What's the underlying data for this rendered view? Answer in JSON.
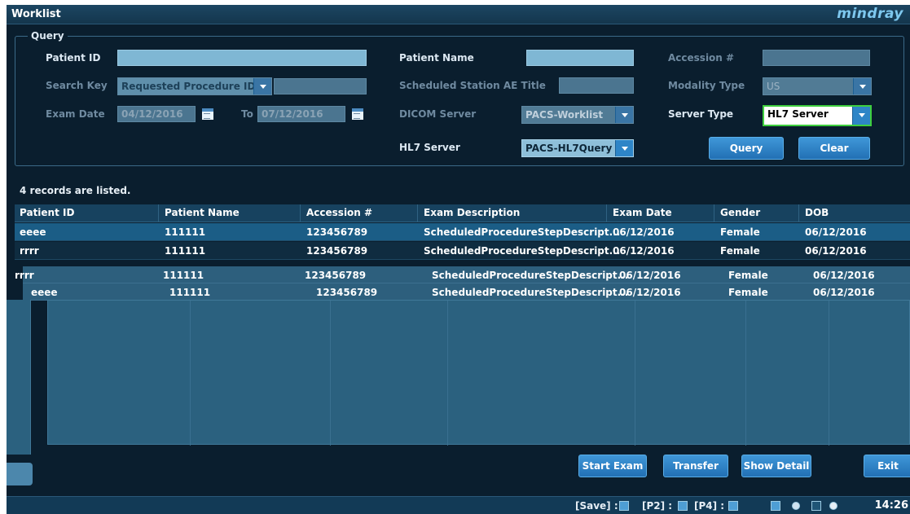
{
  "window": {
    "title": "Worklist",
    "brand": "mindray"
  },
  "query": {
    "legend": "Query",
    "patient_id": {
      "label": "Patient ID",
      "value": ""
    },
    "patient_name": {
      "label": "Patient Name",
      "value": ""
    },
    "accession": {
      "label": "Accession #",
      "value": ""
    },
    "search_key": {
      "label": "Search Key",
      "selected": "Requested Procedure ID",
      "value": ""
    },
    "station_ae": {
      "label": "Scheduled Station AE Title",
      "value": ""
    },
    "modality": {
      "label": "Modality Type",
      "selected": "US"
    },
    "exam_date": {
      "label": "Exam Date",
      "from": "04/12/2016",
      "to_label": "To",
      "to": "07/12/2016"
    },
    "dicom_server": {
      "label": "DICOM Server",
      "selected": "PACS-Worklist"
    },
    "server_type": {
      "label": "Server Type",
      "selected": "HL7 Server"
    },
    "hl7_server": {
      "label": "HL7 Server",
      "selected": "PACS-HL7Query"
    },
    "query_button": "Query",
    "clear_button": "Clear"
  },
  "records_text": "4 records are listed.",
  "table": {
    "columns": [
      "Patient ID",
      "Patient Name",
      "Accession #",
      "Exam Description",
      "Exam Date",
      "Gender",
      "DOB"
    ],
    "rows": [
      [
        "eeee",
        "111111",
        "123456789",
        "ScheduledProcedureStepDescript...",
        "06/12/2016",
        "Female",
        "06/12/2016"
      ],
      [
        "rrrr",
        "111111",
        "123456789",
        "ScheduledProcedureStepDescript...",
        "06/12/2016",
        "Female",
        "06/12/2016"
      ],
      [
        "rrrr",
        "111111",
        "123456789",
        "ScheduledProcedureStepDescript...",
        "06/12/2016",
        "Female",
        "06/12/2016"
      ],
      [
        "eeee",
        "111111",
        "123456789",
        "ScheduledProcedureStepDescript...",
        "06/12/2016",
        "Female",
        "06/12/2016"
      ]
    ],
    "selected_row": 0
  },
  "actions": {
    "start_exam": "Start Exam",
    "transfer": "Transfer",
    "show_detail": "Show Detail",
    "exit": "Exit"
  },
  "status": {
    "save": "[Save] :",
    "p2": "[P2] :",
    "p4": "[P4] :",
    "time": "14:26"
  },
  "colors": {
    "accent": "#2e85c7",
    "selected_row": "#1b5d86",
    "server_type_border": "#3ecf3e"
  }
}
